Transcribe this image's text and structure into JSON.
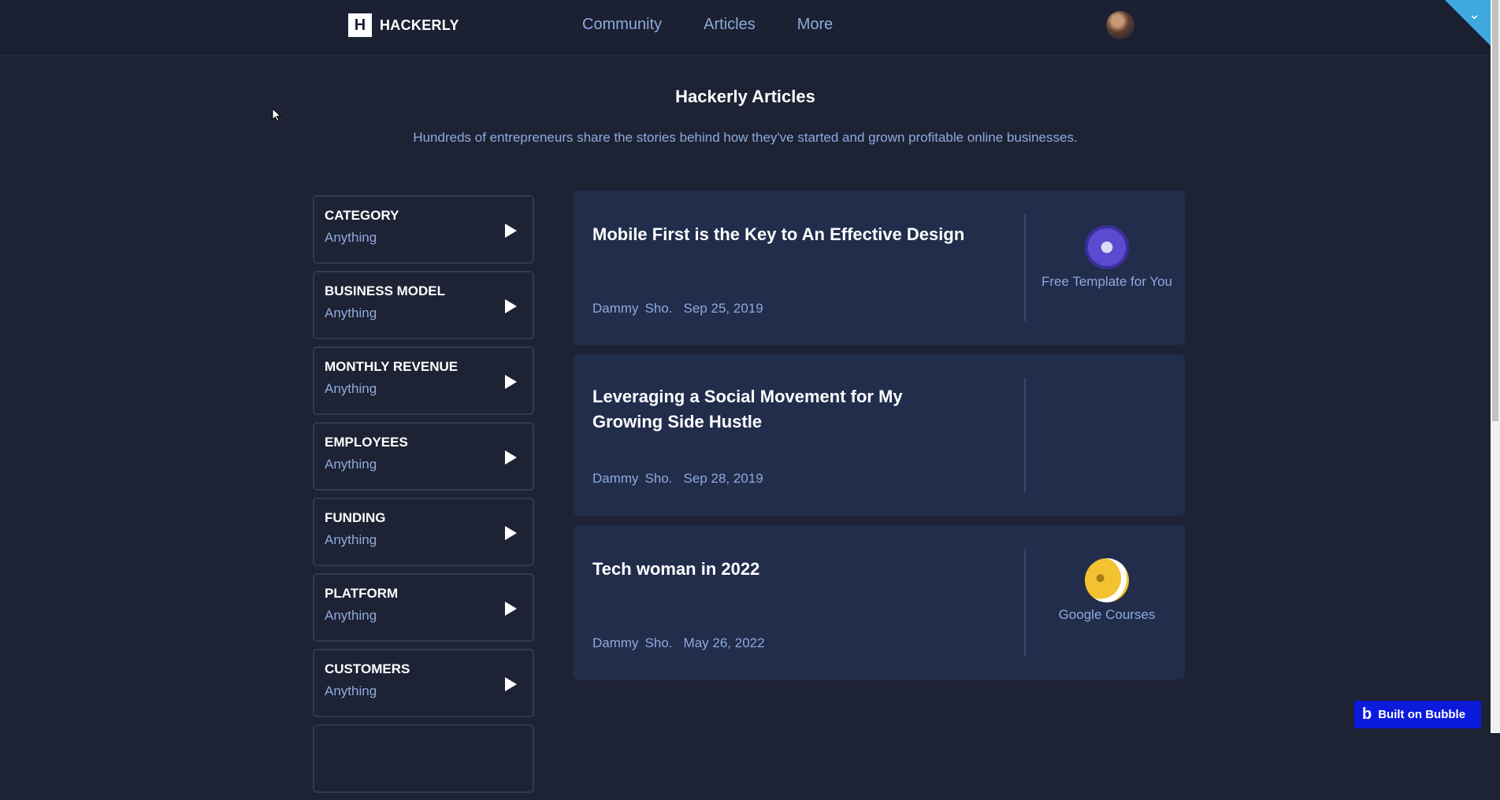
{
  "brand": {
    "logo_letter": "H",
    "name": "HACKERLY"
  },
  "nav": [
    {
      "label": "Community"
    },
    {
      "label": "Articles"
    },
    {
      "label": "More"
    }
  ],
  "page": {
    "title": "Hackerly Articles",
    "subtitle": "Hundreds of entrepreneurs share the stories behind how they've started and grown profitable online businesses."
  },
  "filters": [
    {
      "title": "CATEGORY",
      "value": "Anything"
    },
    {
      "title": "BUSINESS MODEL",
      "value": "Anything"
    },
    {
      "title": "MONTHLY REVENUE",
      "value": "Anything"
    },
    {
      "title": "EMPLOYEES",
      "value": "Anything"
    },
    {
      "title": "FUNDING",
      "value": "Anything"
    },
    {
      "title": "PLATFORM",
      "value": "Anything"
    },
    {
      "title": "CUSTOMERS",
      "value": "Anything"
    }
  ],
  "articles": [
    {
      "title": "Mobile First is the Key to An Effective Design",
      "author_first": "Dammy",
      "author_last": "Sho.",
      "date": "Sep 25, 2019",
      "side_label": "Free Template for You",
      "side_icon": "template-thumbnail"
    },
    {
      "title": "Leveraging a Social Movement for My Growing Side Hustle",
      "author_first": "Dammy",
      "author_last": "Sho.",
      "date": "Sep 28, 2019",
      "side_label": "",
      "side_icon": ""
    },
    {
      "title": "Tech woman in 2022",
      "author_first": "Dammy",
      "author_last": "Sho.",
      "date": "May 26, 2022",
      "side_label": "Google Courses",
      "side_icon": "courses-thumbnail"
    }
  ],
  "badge": {
    "label": "Built on Bubble",
    "logo": "b"
  },
  "colors": {
    "background": "#1d2234",
    "card": "#212d4b",
    "accent_text": "#8fa9dc",
    "corner": "#3fa9dd",
    "badge": "#0c1adc"
  }
}
